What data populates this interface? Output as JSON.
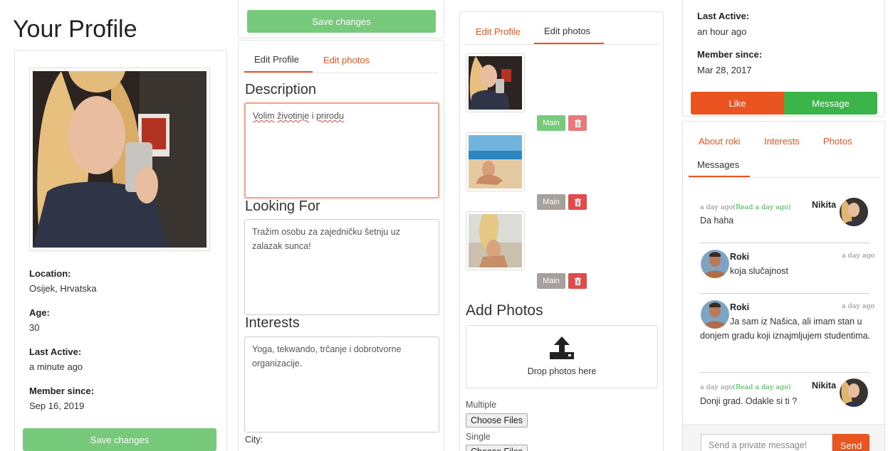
{
  "page": {
    "title": "Your Profile"
  },
  "profile_card": {
    "fields": [
      {
        "label": "Location:",
        "value": "Osijek, Hrvatska"
      },
      {
        "label": "Age:",
        "value": "30"
      },
      {
        "label": "Last Active:",
        "value": "a minute ago"
      },
      {
        "label": "Member since:",
        "value": "Sep 16, 2019"
      }
    ],
    "save_label": "Save changes"
  },
  "edit_form": {
    "save_label": "Save changes",
    "tabs": [
      {
        "label": "Edit Profile"
      },
      {
        "label": "Edit photos"
      }
    ],
    "description_heading": "Description",
    "description_words": [
      "Volim",
      "životinje",
      "i",
      "prirodu"
    ],
    "looking_for_heading": "Looking For",
    "looking_for_value": "Tražim osobu za zajedničku šetnju uz zalazak sunca!",
    "interests_heading": "Interests",
    "interests_value": "Yoga, tekwando, trčanje i dobrotvorne organizacije.",
    "city_label": "City:"
  },
  "photo_editor": {
    "tabs": [
      {
        "label": "Edit Profile"
      },
      {
        "label": "Edit photos"
      }
    ],
    "main_label": "Main",
    "add_heading": "Add Photos",
    "drop_text": "Drop photos here",
    "multiple_label": "Multiple",
    "single_label": "Single",
    "choose_label": "Choose Files"
  },
  "member_panel": {
    "last_active_label": "Last Active:",
    "last_active_value": "an hour ago",
    "member_since_label": "Member since:",
    "member_since_value": "Mar 28, 2017",
    "like_label": "Like",
    "message_label": "Message",
    "tabs": [
      {
        "label": "About roki"
      },
      {
        "label": "Interests"
      },
      {
        "label": "Photos"
      },
      {
        "label": "Messages"
      }
    ],
    "messages": [
      {
        "time": "a day ago",
        "read": "(Read a day ago)",
        "name": "Nikita",
        "text": "Da haha"
      },
      {
        "time": "a day ago",
        "name": "Roki",
        "text": "koja slučajnost"
      },
      {
        "time": "a day ago",
        "name": "Roki",
        "text": "Ja sam iz Našica, ali imam stan u donjem gradu koji iznajmljujem studentima."
      },
      {
        "time": "a day ago",
        "read": "(Read a day ago)",
        "name": "Nikita",
        "text": "Donji grad. Odakle si ti ?"
      }
    ],
    "input_placeholder": "Send a private message!",
    "send_label": "Send"
  },
  "colors": {
    "accent": "#e95420",
    "success": "#3bb54a",
    "success_light": "#77c97b",
    "danger": "#e04b4b",
    "muted": "#a8a09a"
  }
}
